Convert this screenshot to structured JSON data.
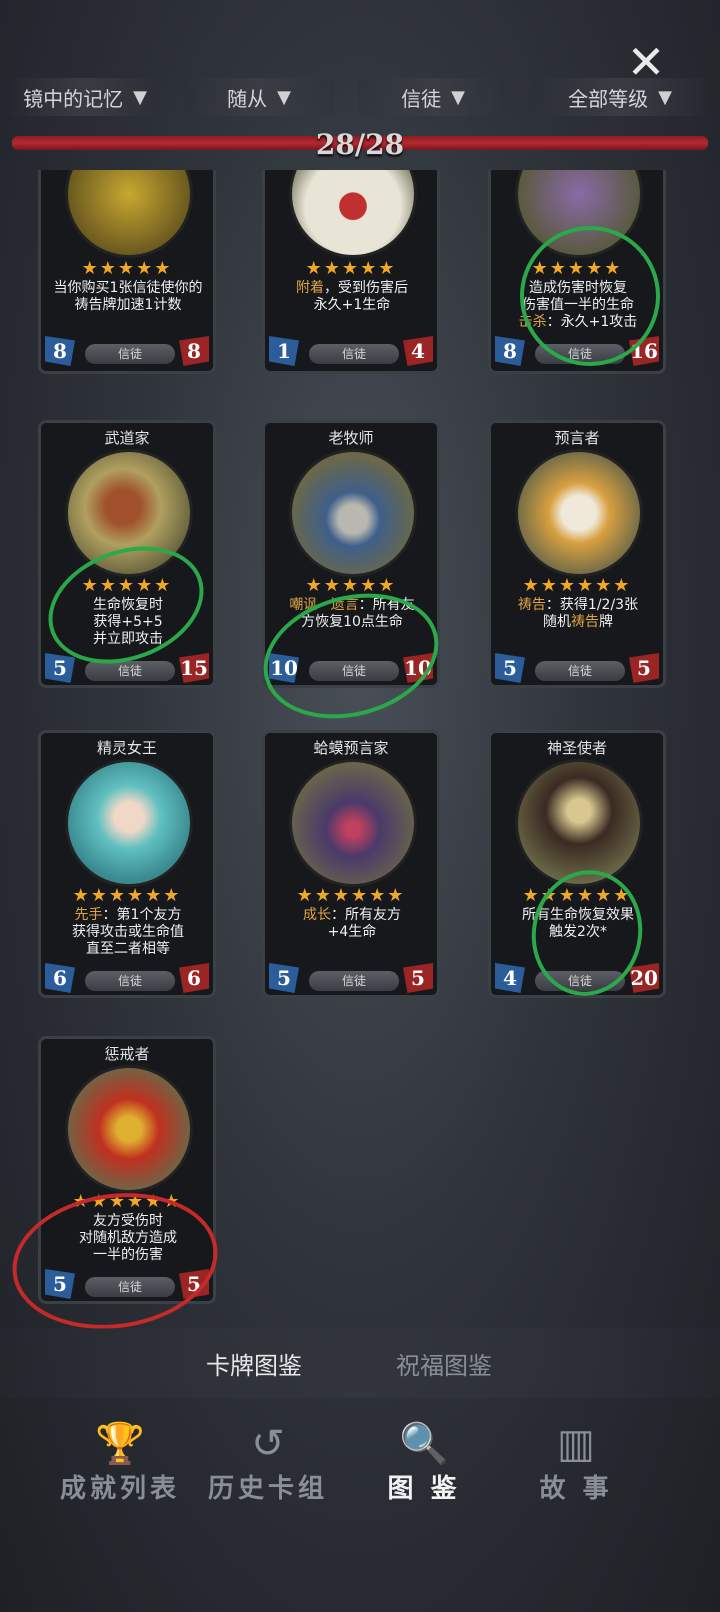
{
  "filters": [
    {
      "label": "镜中的记忆"
    },
    {
      "label": "随从"
    },
    {
      "label": "信徒"
    },
    {
      "label": "全部等级"
    }
  ],
  "counter": "28/28",
  "cards": [
    {
      "name": "",
      "desc": "当你购买1张信徒使你的祷告牌加速1计数",
      "tag": "信徒",
      "atk": "8",
      "hp": "8",
      "stars": "★★★★★"
    },
    {
      "name": "",
      "desc": "附着，受到伤害后永久+1生命",
      "tag": "信徒",
      "atk": "1",
      "hp": "4",
      "stars": "★★★★★"
    },
    {
      "name": "",
      "desc": "造成伤害时恢复伤害值一半的生命 击杀：永久+1攻击",
      "tag": "信徒",
      "atk": "8",
      "hp": "16",
      "stars": "★★★★★"
    },
    {
      "name": "武道家",
      "desc": "生命恢复时获得+5+5并立即攻击",
      "tag": "信徒",
      "atk": "5",
      "hp": "15",
      "stars": "★★★★★"
    },
    {
      "name": "老牧师",
      "desc": "嘲讽 遗言：所有友方恢复10点生命",
      "tag": "信徒",
      "atk": "10",
      "hp": "10",
      "stars": "★★★★★"
    },
    {
      "name": "预言者",
      "desc": "祷告：获得1/2/3张随机祷告牌",
      "tag": "信徒",
      "atk": "5",
      "hp": "5",
      "stars": "★★★★★★"
    },
    {
      "name": "精灵女王",
      "desc": "先手：第1个友方获得攻击或生命值直至二者相等",
      "tag": "信徒",
      "atk": "6",
      "hp": "6",
      "stars": "★★★★★★"
    },
    {
      "name": "蛤蟆预言家",
      "desc": "成长：所有友方+4生命",
      "tag": "信徒",
      "atk": "5",
      "hp": "5",
      "stars": "★★★★★★"
    },
    {
      "name": "神圣使者",
      "desc": "所有生命恢复效果触发2次*",
      "tag": "信徒",
      "atk": "4",
      "hp": "20",
      "stars": "★★★★★★"
    },
    {
      "name": "惩戒者",
      "desc": "友方受伤时对随机敌方造成一半的伤害",
      "tag": "信徒",
      "atk": "5",
      "hp": "5",
      "stars": "★★★★★★"
    }
  ],
  "sub_tabs": {
    "cards": "卡牌图鉴",
    "blessings": "祝福图鉴"
  },
  "nav": {
    "achievements": "成就列表",
    "history": "历史卡组",
    "codex": "图 鉴",
    "story": "故 事"
  },
  "colors": {
    "star": "#f0a825",
    "highlight": "#e0a445",
    "attack": "#2b5d9b",
    "health": "#9b2424",
    "accent_red": "#b32a32"
  }
}
